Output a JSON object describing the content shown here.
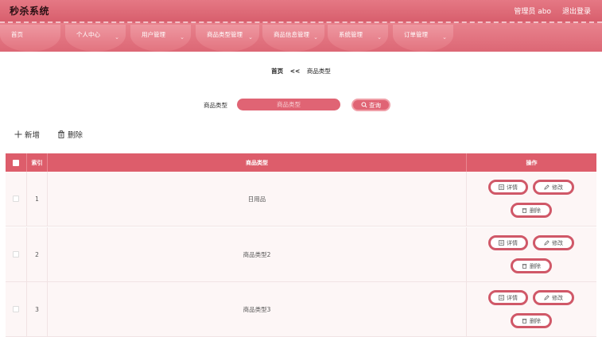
{
  "header": {
    "title": "秒杀系统",
    "user": "管理员 abo",
    "logout": "退出登录"
  },
  "nav": {
    "items": [
      {
        "label": "首页"
      },
      {
        "label": "个人中心"
      },
      {
        "label": "用户管理"
      },
      {
        "label": "商品类型管理"
      },
      {
        "label": "商品信息管理"
      },
      {
        "label": "系统管理"
      },
      {
        "label": "订单管理"
      }
    ]
  },
  "breadcrumb": {
    "home": "首页",
    "sep": "<<",
    "current": "商品类型"
  },
  "search": {
    "label": "商品类型",
    "placeholder": "商品类型",
    "button": "查询"
  },
  "actions": {
    "add": "新增",
    "delete": "删除"
  },
  "table": {
    "headers": {
      "index": "索引",
      "type": "商品类型",
      "ops": "操作"
    },
    "rows": [
      {
        "index": "1",
        "type": "日用品"
      },
      {
        "index": "2",
        "type": "商品类型2"
      },
      {
        "index": "3",
        "type": "商品类型3"
      }
    ],
    "op_labels": {
      "detail": "详情",
      "edit": "修改",
      "delete": "删除"
    }
  },
  "colors": {
    "primary": "#dd5d6b",
    "accent": "#e06474"
  }
}
